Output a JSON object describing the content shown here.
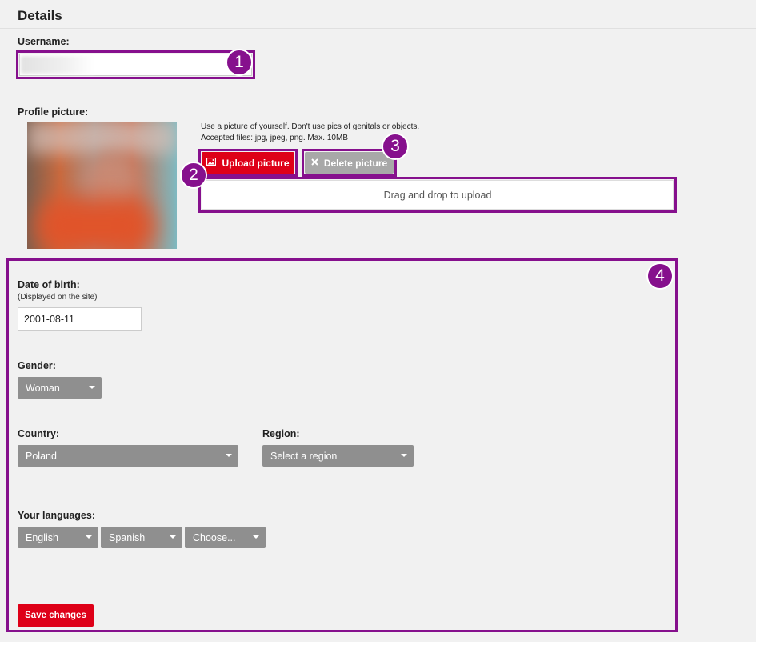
{
  "page": {
    "title": "Details"
  },
  "username": {
    "label": "Username:",
    "value": ""
  },
  "profile_picture": {
    "label": "Profile picture:",
    "hint_line1": "Use a picture of yourself. Don't use pics of genitals or objects.",
    "hint_line2": "Accepted files: jpg, jpeg, png. Max. 10MB",
    "upload_label": "Upload picture",
    "delete_label": "Delete picture",
    "dropzone_text": "Drag and drop to upload",
    "upload_icon": "image-icon",
    "delete_icon": "x-icon"
  },
  "birth": {
    "label": "Date of birth:",
    "sublabel": "(Displayed on the site)",
    "value": "2001-08-11"
  },
  "gender": {
    "label": "Gender:",
    "selected": "Woman"
  },
  "country": {
    "label": "Country:",
    "selected": "Poland"
  },
  "region": {
    "label": "Region:",
    "selected": "Select a region"
  },
  "languages": {
    "label": "Your languages:",
    "items": [
      "English",
      "Spanish",
      "Choose..."
    ]
  },
  "save": {
    "label": "Save changes"
  },
  "annotations": [
    "1",
    "2",
    "3",
    "4"
  ],
  "colors": {
    "accent_red": "#de0018",
    "annotation_purple": "#86108d",
    "select_gray": "#8f8f8f"
  }
}
